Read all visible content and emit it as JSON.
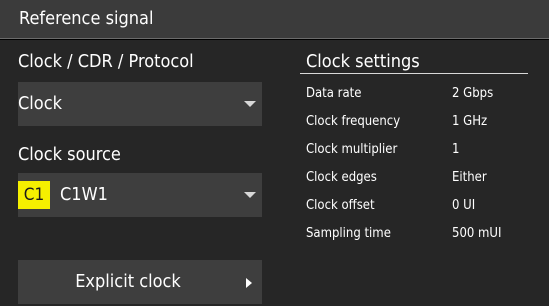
{
  "window": {
    "title": "Reference signal"
  },
  "reference": {
    "type_label": "Clock / CDR / Protocol",
    "type_value": "Clock",
    "source_label": "Clock source",
    "source_badge": "C1",
    "source_value": "C1W1",
    "source_badge_color": "#f5f000",
    "explicit_clock_label": "Explicit clock"
  },
  "clock_settings": {
    "title": "Clock settings",
    "rows": [
      {
        "label": "Data rate",
        "value": "2 Gbps"
      },
      {
        "label": "Clock frequency",
        "value": "1 GHz"
      },
      {
        "label": "Clock multiplier",
        "value": "1"
      },
      {
        "label": "Clock edges",
        "value": "Either"
      },
      {
        "label": "Clock offset",
        "value": "0 UI"
      },
      {
        "label": "Sampling time",
        "value": "500 mUI"
      }
    ]
  }
}
